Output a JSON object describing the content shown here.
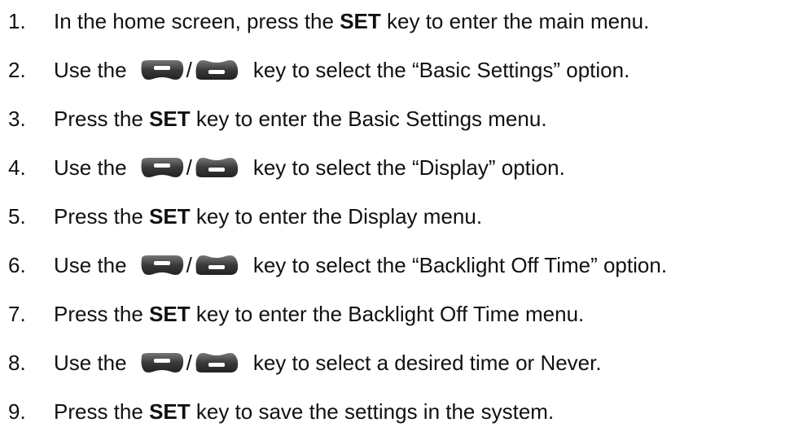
{
  "steps": [
    {
      "number": "1.",
      "text_before": "In the home screen, press the ",
      "bold": "SET",
      "text_after": " key to enter the main menu."
    },
    {
      "number": "2.",
      "text_before": "Use the",
      "separator": "/",
      "text_after": "key to select the “Basic Settings” option.",
      "icons": [
        "up-key-icon",
        "down-key-icon"
      ]
    },
    {
      "number": "3.",
      "text_before": "Press the ",
      "bold": "SET",
      "text_after": " key to enter the Basic Settings menu."
    },
    {
      "number": "4.",
      "text_before": "Use the",
      "separator": "/",
      "text_after": "key to select the “Display” option.",
      "icons": [
        "up-key-icon",
        "down-key-icon"
      ]
    },
    {
      "number": "5.",
      "text_before": "Press the ",
      "bold": "SET",
      "text_after": " key to enter the Display menu."
    },
    {
      "number": "6.",
      "text_before": "Use the",
      "separator": "/",
      "text_after": "key to select the “Backlight Off Time” option.",
      "icons": [
        "up-key-icon",
        "down-key-icon"
      ]
    },
    {
      "number": "7.",
      "text_before": "Press the ",
      "bold": "SET",
      "text_after": " key to enter the Backlight Off Time menu."
    },
    {
      "number": "8.",
      "text_before": "Use the",
      "separator": "/",
      "text_after": "key to select a desired time or Never.",
      "icons": [
        "up-key-icon",
        "down-key-icon"
      ]
    },
    {
      "number": "9.",
      "text_before": "Press the ",
      "bold": "SET",
      "text_after": " key to save the settings in the system."
    }
  ],
  "colors": {
    "text": "#111111",
    "key_dark": "#3a3a3a",
    "key_mid": "#6a6a6a",
    "key_highlight": "#ffffff"
  }
}
